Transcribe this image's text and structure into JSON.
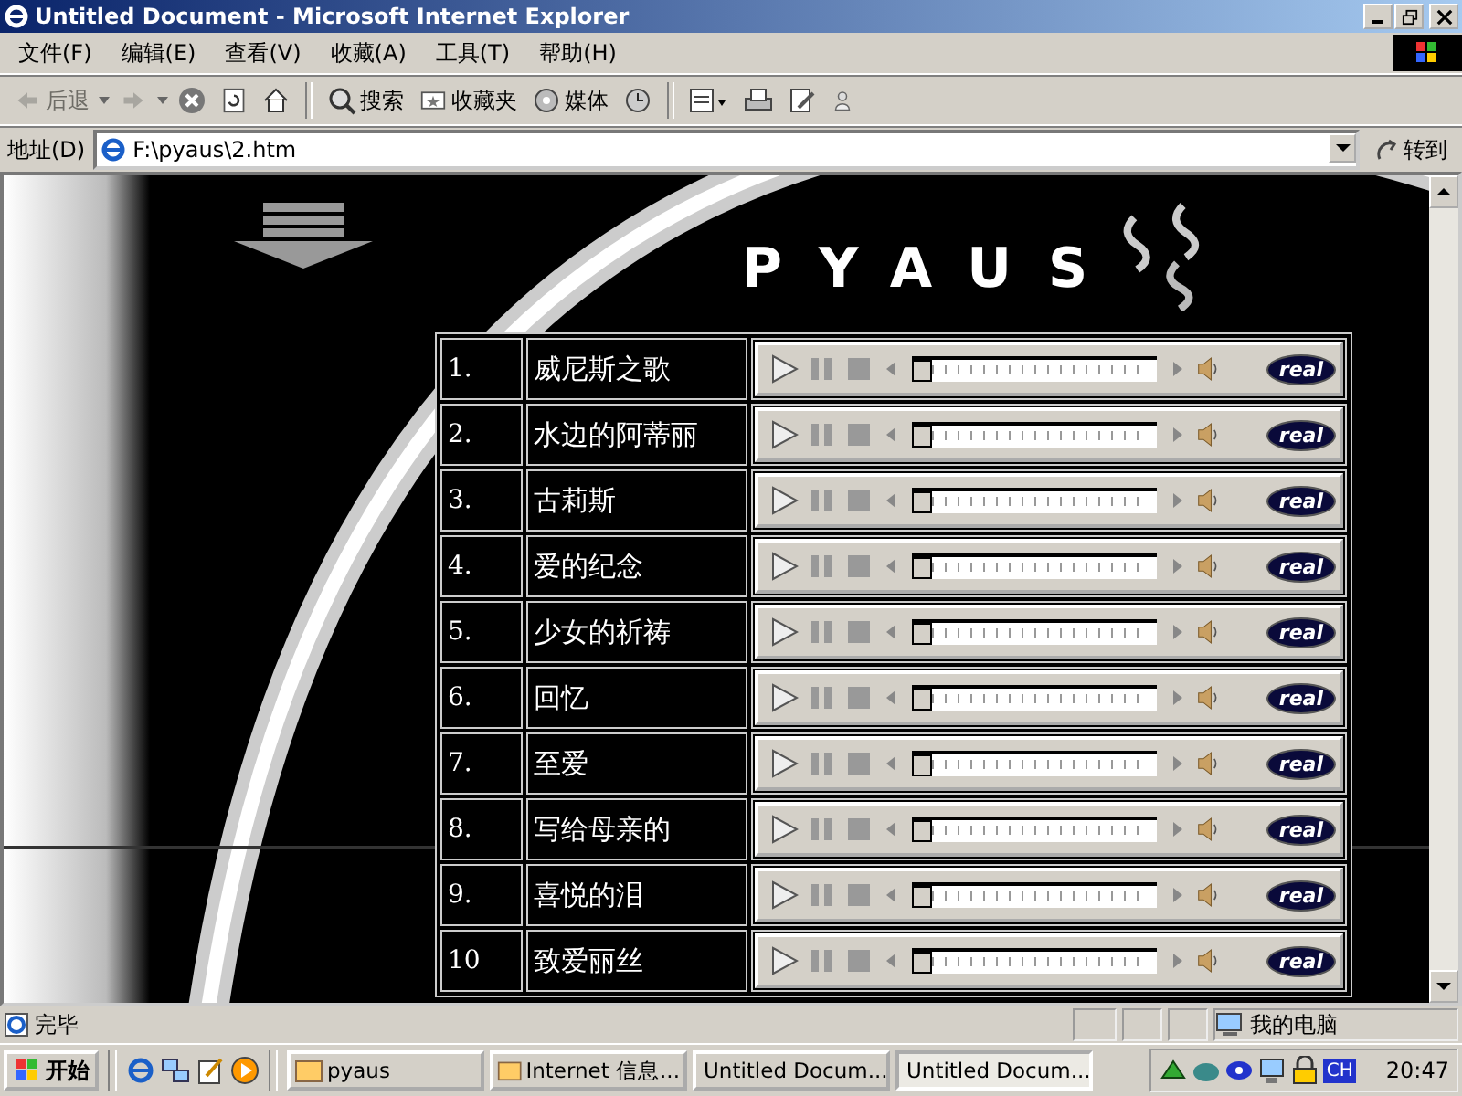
{
  "window": {
    "title": "Untitled Document - Microsoft Internet Explorer"
  },
  "menu": [
    "文件(F)",
    "编辑(E)",
    "查看(V)",
    "收藏(A)",
    "工具(T)",
    "帮助(H)"
  ],
  "toolbar": {
    "back": {
      "label": "后退",
      "disabled": true
    },
    "search": "搜索",
    "favorites": "收藏夹",
    "media": "媒体"
  },
  "address": {
    "label": "地址(D)",
    "value": "F:\\pyaus\\2.htm",
    "go": "转到"
  },
  "page": {
    "logo": "PYAUS",
    "tracks": [
      {
        "number": "1.",
        "title": "威尼斯之歌",
        "level": 0,
        "brand": "real"
      },
      {
        "number": "2.",
        "title": "水边的阿蒂丽",
        "level": 0,
        "brand": "real"
      },
      {
        "number": "3.",
        "title": "古莉斯",
        "level": 0,
        "brand": "real"
      },
      {
        "number": "4.",
        "title": "爱的纪念",
        "level": 0,
        "brand": "real"
      },
      {
        "number": "5.",
        "title": "少女的祈祷",
        "level": 0,
        "brand": "real"
      },
      {
        "number": "6.",
        "title": "回忆",
        "level": 0,
        "brand": "real"
      },
      {
        "number": "7.",
        "title": "至爱",
        "level": 0,
        "brand": "real"
      },
      {
        "number": "8.",
        "title": "写给母亲的",
        "level": 0,
        "brand": "real"
      },
      {
        "number": "9.",
        "title": "喜悦的泪",
        "level": 0,
        "brand": "real"
      },
      {
        "number": "10",
        "title": "致爱丽丝",
        "level": 0,
        "brand": "real"
      }
    ]
  },
  "status_bar": {
    "text": "完毕",
    "zone": "我的电脑"
  },
  "taskbar": {
    "start": "开始",
    "tasks": [
      {
        "label": "pyaus",
        "selected": false
      },
      {
        "label": "Internet 信息...",
        "selected": false
      },
      {
        "label": "Untitled Docum...",
        "selected": false
      },
      {
        "label": "Untitled Docum...",
        "selected": true
      }
    ],
    "language": "CH",
    "clock": "20:47"
  }
}
